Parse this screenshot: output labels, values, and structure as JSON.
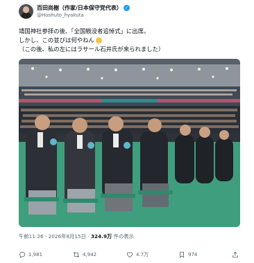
{
  "author": {
    "display_name": "百田尚樹（作家/日本保守党代表）",
    "handle": "@Hoshuto_hyakuta",
    "verified_glyph": "✓"
  },
  "post": {
    "lines": [
      "靖国神社参拝の後、「全国戦没者追悼式」に出席。",
      "しかし、この並びは何やねん",
      "（この後、私の左にはラサール石井氏が来られました）"
    ],
    "emoji": "grinning-sweat-emoji"
  },
  "photo": {
    "description_icon": "ceremony-photo"
  },
  "meta": {
    "time": "午前11:26",
    "sep": " · ",
    "date": "2026年8月15日",
    "views_count": "324.9万",
    "views_label": "件の表示"
  },
  "actions": {
    "reply_count": "1,981",
    "repost_count": "4,942",
    "like_count": "4.7万",
    "bookmark_count": "974"
  },
  "colors": {
    "accent": "#1d9bf0",
    "muted": "#536471",
    "text": "#0f1419",
    "carpet": "#3f9e7e"
  }
}
